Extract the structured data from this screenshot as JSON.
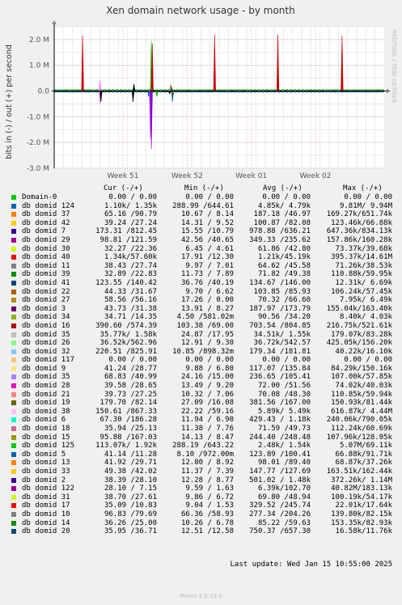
{
  "chart_data": {
    "type": "line",
    "title": "Xen domain network usage - by month",
    "ylabel": "bits in (-) / out (+) per second",
    "side_label": "RRDTOOL / TOBI OETIKER",
    "ylim": [
      -3000000,
      2500000
    ],
    "yticks": [
      {
        "v": 2000000,
        "label": "2.0 M"
      },
      {
        "v": 1000000,
        "label": "1.0 M"
      },
      {
        "v": 0,
        "label": "0.0"
      },
      {
        "v": -1000000,
        "label": "-1.0 M"
      },
      {
        "v": -2000000,
        "label": "-2.0 M"
      },
      {
        "v": -3000000,
        "label": "-3.0 M"
      }
    ],
    "xlim": [
      0,
      36
    ],
    "xticks": [
      {
        "v": 7.5,
        "label": "Week 51"
      },
      {
        "v": 14.5,
        "label": "Week 52"
      },
      {
        "v": 21.5,
        "label": "Week 01"
      },
      {
        "v": 28.5,
        "label": "Week 02"
      }
    ],
    "grid": true,
    "spikes": [
      {
        "x": 3.1,
        "y": 2150000,
        "color": "#cc0000"
      },
      {
        "x": 10.6,
        "y": 1950000,
        "color": "#00cc00"
      },
      {
        "x": 10.7,
        "y": 1850000,
        "color": "#cc0000"
      },
      {
        "x": 17.5,
        "y": 2200000,
        "color": "#cc0000"
      },
      {
        "x": 24.4,
        "y": 2200000,
        "color": "#cc0000"
      },
      {
        "x": 31.4,
        "y": 2150000,
        "color": "#cc0000"
      },
      {
        "x": 5.0,
        "y": 420000,
        "color": "#ff77ff"
      },
      {
        "x": 8.7,
        "y": 280000,
        "color": "#000000"
      },
      {
        "x": 12.7,
        "y": 280000,
        "color": "#ff8000"
      },
      {
        "x": 12.8,
        "y": 190000,
        "color": "#0066b3"
      },
      {
        "x": 5.0,
        "y": -520000,
        "color": "#ff77ff"
      },
      {
        "x": 5.1,
        "y": -420000,
        "color": "#000000"
      },
      {
        "x": 8.6,
        "y": -420000,
        "color": "#000000"
      },
      {
        "x": 10.3,
        "y": -220000,
        "color": "#0066b3"
      },
      {
        "x": 10.5,
        "y": -1850000,
        "color": "#b33dff"
      },
      {
        "x": 10.6,
        "y": -2250000,
        "color": "#8000cc"
      },
      {
        "x": 11.2,
        "y": -220000,
        "color": "#00aa00"
      },
      {
        "x": 12.6,
        "y": -110000,
        "color": "#000000"
      },
      {
        "x": 12.9,
        "y": -420000,
        "color": "#0066b3"
      },
      {
        "x": 13.0,
        "y": -160000,
        "color": "#aa6600"
      }
    ],
    "legend_columns": [
      "Cur (-/+)",
      "Min (-/+)",
      "Avg (-/+)",
      "Max (-/+)"
    ],
    "series": [
      {
        "name": "Domain-0",
        "color": "#00cc00",
        "cur": "0.00 / 0.00",
        "min": "0.00 / 0.00",
        "avg": "0.00 / 0.00",
        "max": "0.00 / 0.00"
      },
      {
        "name": "db domid 124",
        "color": "#0066b3",
        "cur": "1.10k/ 1.35k",
        "min": "288.99 /644.61",
        "avg": "4.85k/ 4.79k",
        "max": "9.81M/ 9.94M"
      },
      {
        "name": "db domid 37",
        "color": "#ff8000",
        "cur": "65.16 /90.79",
        "min": "10.67 / 8.14",
        "avg": "187.18 /46.97",
        "max": "169.27k/651.74k"
      },
      {
        "name": "db domid 42",
        "color": "#ffcc00",
        "cur": "39.24 /27.24",
        "min": "14.31 / 9.52",
        "avg": "100.87 /82.08",
        "max": "123.46k/66.88k"
      },
      {
        "name": "db domid 7",
        "color": "#330099",
        "cur": "173.31 /812.45",
        "min": "15.55 /10.79",
        "avg": "978.88 /636.21",
        "max": "647.36k/834.13k"
      },
      {
        "name": "db domid 29",
        "color": "#990099",
        "cur": "98.81 /121.59",
        "min": "42.56 /40.65",
        "avg": "349.33 /235.62",
        "max": "157.86k/160.28k"
      },
      {
        "name": "db domid 30",
        "color": "#ccff00",
        "cur": "32.27 /22.36",
        "min": "6.45 / 4.61",
        "avg": "61.86 /42.80",
        "max": "73.37k/39.68k"
      },
      {
        "name": "db domid 40",
        "color": "#ff0000",
        "cur": "1.34k/57.60k",
        "min": "17.91 /12.30",
        "avg": "1.21k/45.19k",
        "max": "395.37k/14.61M"
      },
      {
        "name": "db domid 11",
        "color": "#808080",
        "cur": "38.43 /27.74",
        "min": "9.97 / 7.01",
        "avg": "64.62 /45.58",
        "max": "71.26k/38.53k"
      },
      {
        "name": "db domid 39",
        "color": "#008f00",
        "cur": "32.89 /22.83",
        "min": "11.73 / 7.89",
        "avg": "71.82 /49.38",
        "max": "110.88k/59.95k"
      },
      {
        "name": "db domid 41",
        "color": "#00487d",
        "cur": "123.55 /140.42",
        "min": "36.76 /40.19",
        "avg": "134.67 /146.00",
        "max": "12.31k/ 6.69k"
      },
      {
        "name": "db domid 22",
        "color": "#b35a00",
        "cur": "44.33 /31.67",
        "min": "9.70 / 6.62",
        "avg": "103.85 /85.93",
        "max": "106.24k/57.45k"
      },
      {
        "name": "db domid 27",
        "color": "#b38f00",
        "cur": "58.56 /56.16",
        "min": "17.26 / 0.00",
        "avg": "70.32 /66.60",
        "max": "7.95k/ 6.49k"
      },
      {
        "name": "db domid 3",
        "color": "#6b006b",
        "cur": "43.73 /31.38",
        "min": "13.91 / 8.27",
        "avg": "187.97 /173.79",
        "max": "155.04k/163.40k"
      },
      {
        "name": "db domid 34",
        "color": "#8fb300",
        "cur": "34.71 /14.35",
        "min": "4.50 /581.02m",
        "avg": "90.56 /34.20",
        "max": "8.40k/ 4.03k"
      },
      {
        "name": "db domid 16",
        "color": "#b30000",
        "cur": "390.60 /574.39",
        "min": "103.38 /69.00",
        "avg": "703.54 /804.85",
        "max": "216.75k/521.61k"
      },
      {
        "name": "db domid 35",
        "color": "#bebebe",
        "cur": "35.77k/ 1.58k",
        "min": "24.87 /17.95",
        "avg": "34.51k/ 1.55k",
        "max": "179.07k/83.28k"
      },
      {
        "name": "db domid 26",
        "color": "#80ff80",
        "cur": "36.52k/562.96",
        "min": "12.91 / 9.30",
        "avg": "36.72k/542.57",
        "max": "425.05k/156.20k"
      },
      {
        "name": "db domid 32",
        "color": "#80c9ff",
        "cur": "220.51 /825.91",
        "min": "10.85 /898.32m",
        "avg": "179.34 /181.81",
        "max": "40.22k/16.10k"
      },
      {
        "name": "db domid 117",
        "color": "#ffc080",
        "cur": "0.00 / 0.00",
        "min": "0.00 / 0.00",
        "avg": "0.00 / 0.00",
        "max": "0.00 / 0.00"
      },
      {
        "name": "db domid 9",
        "color": "#ffe680",
        "cur": "41.24 /28.77",
        "min": "9.88 / 6.80",
        "avg": "117.07 /135.84",
        "max": "84.29k/150.16k"
      },
      {
        "name": "db domid 35",
        "color": "#aa80ff",
        "cur": "68.83 /40.99",
        "min": "24.16 /15.00",
        "avg": "236.65 /105.41",
        "max": "107.00k/57.85k"
      },
      {
        "name": "db domid 28",
        "color": "#ee00cc",
        "cur": "39.58 /28.65",
        "min": "13.49 / 9.20",
        "avg": "72.00 /51.56",
        "max": "74.02k/40.03k"
      },
      {
        "name": "db domid 21",
        "color": "#ff8080",
        "cur": "39.73 /27.25",
        "min": "10.32 / 7.06",
        "avg": "70.08 /48.30",
        "max": "110.85k/59.94k"
      },
      {
        "name": "db domid 19",
        "color": "#666600",
        "cur": "179.70 /82.14",
        "min": "27.09 /16.08",
        "avg": "381.56 /167.00",
        "max": "150.93k/81.44k"
      },
      {
        "name": "db domid 38",
        "color": "#ffbfff",
        "cur": "150.61 /867.33",
        "min": "22.22 /59.16",
        "avg": "5.89k/ 5.49k",
        "max": "616.87k/ 4.44M"
      },
      {
        "name": "db domid 6",
        "color": "#00ffcc",
        "cur": "67.30 /186.28",
        "min": "11.94 / 6.90",
        "avg": "429.43 / 1.18k",
        "max": "240.06k/790.05k"
      },
      {
        "name": "db domid 18",
        "color": "#cc6699",
        "cur": "35.94 /25.13",
        "min": "11.38 / 7.76",
        "avg": "71.59 /49.73",
        "max": "112.24k/60.69k"
      },
      {
        "name": "db domid 15",
        "color": "#999900",
        "cur": "95.88 /167.03",
        "min": "14.13 / 8.47",
        "avg": "244.40 /248.48",
        "max": "107.96k/128.05k"
      },
      {
        "name": "db domid 125",
        "color": "#00cc00",
        "cur": "113.07k/ 1.92k",
        "min": "288.19 /643.22",
        "avg": "2.48k/ 1.54k",
        "max": "5.07M/69.11k"
      },
      {
        "name": "db domid 5",
        "color": "#0066b3",
        "cur": "41.14 /11.28",
        "min": "8.10 /972.00m",
        "avg": "123.89 /100.41",
        "max": "66.88k/91.71k"
      },
      {
        "name": "db domid 13",
        "color": "#ff8000",
        "cur": "41.92 /29.71",
        "min": "12.80 / 8.92",
        "avg": "98.01 /89.40",
        "max": "68.87k/37.26k"
      },
      {
        "name": "db domid 33",
        "color": "#ffcc00",
        "cur": "49.38 /42.02",
        "min": "11.37 / 7.39",
        "avg": "147.77 /127.69",
        "max": "163.51k/162.44k"
      },
      {
        "name": "db domid 2",
        "color": "#330099",
        "cur": "38.39 /28.10",
        "min": "12.28 / 8.77",
        "avg": "501.02 / 1.48k",
        "max": "372.26k/ 1.14M"
      },
      {
        "name": "db domid 122",
        "color": "#990099",
        "cur": "28.10 / 7.15",
        "min": "9.59 / 1.63",
        "avg": "6.39k/102.70",
        "max": "40.82M/183.13k"
      },
      {
        "name": "db domid 31",
        "color": "#ccff00",
        "cur": "38.70 /27.61",
        "min": "9.86 / 6.72",
        "avg": "69.80 /48.94",
        "max": "100.19k/54.17k"
      },
      {
        "name": "db domid 17",
        "color": "#ff0000",
        "cur": "35.09 /10.83",
        "min": "9.04 / 1.53",
        "avg": "329.52 /245.74",
        "max": "22.01k/17.64k"
      },
      {
        "name": "db domid 10",
        "color": "#808080",
        "cur": "96.83 /79.69",
        "min": "66.36 /58.93",
        "avg": "277.34 /204.26",
        "max": "139.80k/82.15k"
      },
      {
        "name": "db domid 14",
        "color": "#008f00",
        "cur": "36.26 /25.00",
        "min": "10.26 / 6.78",
        "avg": "85.22 /59.63",
        "max": "153.35k/82.93k"
      },
      {
        "name": "db domid 20",
        "color": "#00487d",
        "cur": "35.95 /36.71",
        "min": "12.51 /12.58",
        "avg": "750.37 /657.30",
        "max": "16.58k/11.76k"
      }
    ]
  },
  "footer": {
    "last_update": "Last update:  Wed Jan 15 10:55:00 2025",
    "generator": "Munin 2.0.33-1"
  }
}
